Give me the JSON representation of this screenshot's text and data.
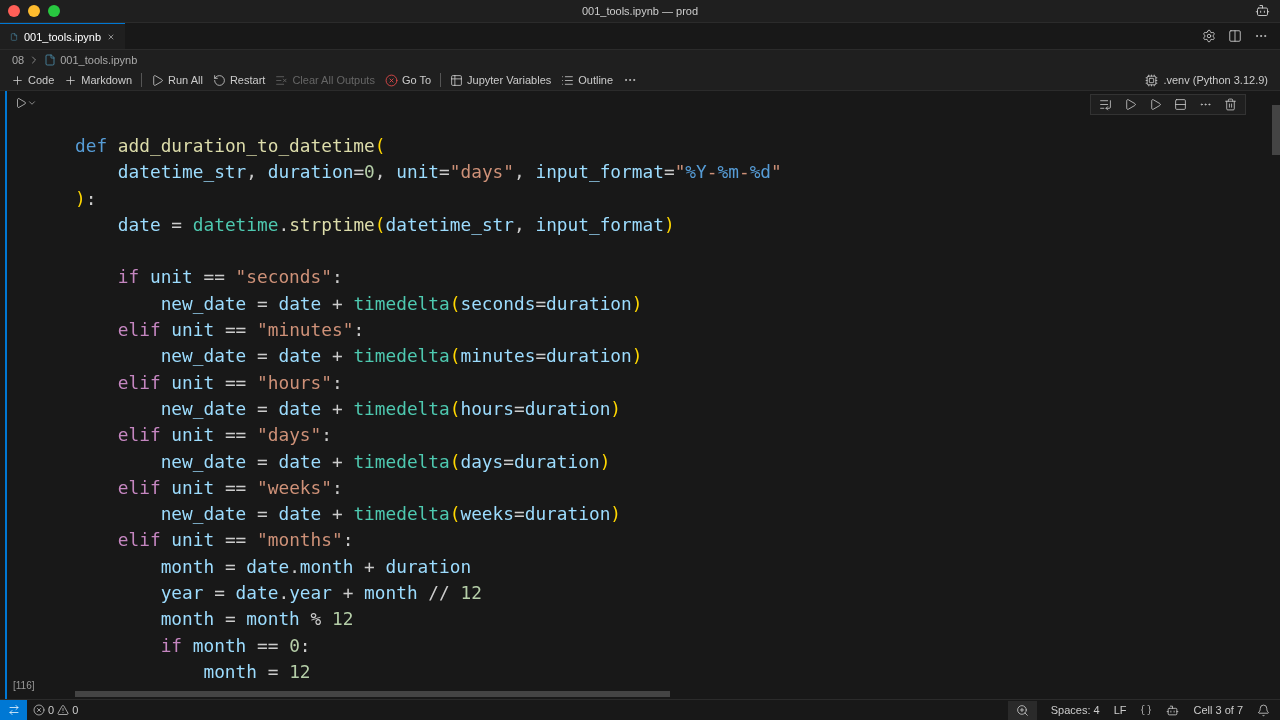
{
  "window": {
    "title": "001_tools.ipynb — prod"
  },
  "tabs": [
    {
      "label": "001_tools.ipynb",
      "selected": true
    }
  ],
  "breadcrumb": [
    "08",
    "001_tools.ipynb"
  ],
  "toolbar": {
    "groups": [
      [
        {
          "label": "Code",
          "disabled": false
        },
        {
          "label": "Markdown",
          "disabled": false
        }
      ],
      [
        {
          "label": "Run All",
          "disabled": false
        },
        {
          "label": "Restart",
          "disabled": false
        },
        {
          "label": "Clear All Outputs",
          "disabled": true
        },
        {
          "label": "Go To",
          "disabled": false
        }
      ],
      [
        {
          "label": "Jupyter Variables",
          "disabled": false
        },
        {
          "label": "Outline",
          "disabled": false
        }
      ]
    ],
    "kernel": ".venv (Python 3.12.9)"
  },
  "cell": {
    "execution_count": "[116]",
    "lines": [
      {
        "tokens": [
          {
            "kind": "keyword",
            "text": "def "
          },
          {
            "kind": "function",
            "text": "add_duration_to_datetime"
          },
          {
            "kind": "bracket",
            "text": "("
          }
        ]
      },
      {
        "tokens": [
          {
            "kind": "variable",
            "text": "    datetime_str"
          },
          {
            "kind": "plain",
            "text": ", "
          },
          {
            "kind": "variable",
            "text": "duration"
          },
          {
            "kind": "plain",
            "text": "="
          },
          {
            "kind": "number",
            "text": "0"
          },
          {
            "kind": "plain",
            "text": ", "
          },
          {
            "kind": "variable",
            "text": "unit"
          },
          {
            "kind": "plain",
            "text": "="
          },
          {
            "kind": "string",
            "text": "\"days\""
          },
          {
            "kind": "plain",
            "text": ", "
          },
          {
            "kind": "variable",
            "text": "input_format"
          },
          {
            "kind": "plain",
            "text": "="
          },
          {
            "kind": "string",
            "text": "\""
          },
          {
            "kind": "format",
            "text": "%Y"
          },
          {
            "kind": "string",
            "text": "-"
          },
          {
            "kind": "format",
            "text": "%m"
          },
          {
            "kind": "string",
            "text": "-"
          },
          {
            "kind": "format",
            "text": "%d"
          },
          {
            "kind": "string",
            "text": "\""
          }
        ]
      },
      {
        "tokens": [
          {
            "kind": "bracket",
            "text": ")"
          },
          {
            "kind": "plain",
            "text": ":"
          }
        ]
      },
      {
        "tokens": [
          {
            "kind": "variable",
            "text": "    date"
          },
          {
            "kind": "plain",
            "text": " = "
          },
          {
            "kind": "class",
            "text": "datetime"
          },
          {
            "kind": "plain",
            "text": "."
          },
          {
            "kind": "function",
            "text": "strptime"
          },
          {
            "kind": "bracket",
            "text": "("
          },
          {
            "kind": "variable",
            "text": "datetime_str"
          },
          {
            "kind": "plain",
            "text": ", "
          },
          {
            "kind": "variable",
            "text": "input_format"
          },
          {
            "kind": "bracket",
            "text": ")"
          }
        ]
      },
      {
        "gap_before": true,
        "tokens": [
          {
            "kind": "control",
            "text": "    if "
          },
          {
            "kind": "variable",
            "text": "unit"
          },
          {
            "kind": "plain",
            "text": " == "
          },
          {
            "kind": "string",
            "text": "\"seconds\""
          },
          {
            "kind": "plain",
            "text": ":"
          }
        ]
      },
      {
        "tokens": [
          {
            "kind": "variable",
            "text": "        new_date"
          },
          {
            "kind": "plain",
            "text": " = "
          },
          {
            "kind": "variable",
            "text": "date"
          },
          {
            "kind": "plain",
            "text": " + "
          },
          {
            "kind": "class",
            "text": "timedelta"
          },
          {
            "kind": "bracket",
            "text": "("
          },
          {
            "kind": "variable",
            "text": "seconds"
          },
          {
            "kind": "plain",
            "text": "="
          },
          {
            "kind": "variable",
            "text": "duration"
          },
          {
            "kind": "bracket",
            "text": ")"
          }
        ]
      },
      {
        "tokens": [
          {
            "kind": "control",
            "text": "    elif "
          },
          {
            "kind": "variable",
            "text": "unit"
          },
          {
            "kind": "plain",
            "text": " == "
          },
          {
            "kind": "string",
            "text": "\"minutes\""
          },
          {
            "kind": "plain",
            "text": ":"
          }
        ]
      },
      {
        "tokens": [
          {
            "kind": "variable",
            "text": "        new_date"
          },
          {
            "kind": "plain",
            "text": " = "
          },
          {
            "kind": "variable",
            "text": "date"
          },
          {
            "kind": "plain",
            "text": " + "
          },
          {
            "kind": "class",
            "text": "timedelta"
          },
          {
            "kind": "bracket",
            "text": "("
          },
          {
            "kind": "variable",
            "text": "minutes"
          },
          {
            "kind": "plain",
            "text": "="
          },
          {
            "kind": "variable",
            "text": "duration"
          },
          {
            "kind": "bracket",
            "text": ")"
          }
        ]
      },
      {
        "tokens": [
          {
            "kind": "control",
            "text": "    elif "
          },
          {
            "kind": "variable",
            "text": "unit"
          },
          {
            "kind": "plain",
            "text": " == "
          },
          {
            "kind": "string",
            "text": "\"hours\""
          },
          {
            "kind": "plain",
            "text": ":"
          }
        ]
      },
      {
        "tokens": [
          {
            "kind": "variable",
            "text": "        new_date"
          },
          {
            "kind": "plain",
            "text": " = "
          },
          {
            "kind": "variable",
            "text": "date"
          },
          {
            "kind": "plain",
            "text": " + "
          },
          {
            "kind": "class",
            "text": "timedelta"
          },
          {
            "kind": "bracket",
            "text": "("
          },
          {
            "kind": "variable",
            "text": "hours"
          },
          {
            "kind": "plain",
            "text": "="
          },
          {
            "kind": "variable",
            "text": "duration"
          },
          {
            "kind": "bracket",
            "text": ")"
          }
        ]
      },
      {
        "tokens": [
          {
            "kind": "control",
            "text": "    elif "
          },
          {
            "kind": "variable",
            "text": "unit"
          },
          {
            "kind": "plain",
            "text": " == "
          },
          {
            "kind": "string",
            "text": "\"days\""
          },
          {
            "kind": "plain",
            "text": ":"
          }
        ]
      },
      {
        "tokens": [
          {
            "kind": "variable",
            "text": "        new_date"
          },
          {
            "kind": "plain",
            "text": " = "
          },
          {
            "kind": "variable",
            "text": "date"
          },
          {
            "kind": "plain",
            "text": " + "
          },
          {
            "kind": "class",
            "text": "timedelta"
          },
          {
            "kind": "bracket",
            "text": "("
          },
          {
            "kind": "variable",
            "text": "days"
          },
          {
            "kind": "plain",
            "text": "="
          },
          {
            "kind": "variable",
            "text": "duration"
          },
          {
            "kind": "bracket",
            "text": ")"
          }
        ]
      },
      {
        "tokens": [
          {
            "kind": "control",
            "text": "    elif "
          },
          {
            "kind": "variable",
            "text": "unit"
          },
          {
            "kind": "plain",
            "text": " == "
          },
          {
            "kind": "string",
            "text": "\"weeks\""
          },
          {
            "kind": "plain",
            "text": ":"
          }
        ]
      },
      {
        "tokens": [
          {
            "kind": "variable",
            "text": "        new_date"
          },
          {
            "kind": "plain",
            "text": " = "
          },
          {
            "kind": "variable",
            "text": "date"
          },
          {
            "kind": "plain",
            "text": " + "
          },
          {
            "kind": "class",
            "text": "timedelta"
          },
          {
            "kind": "bracket",
            "text": "("
          },
          {
            "kind": "variable",
            "text": "weeks"
          },
          {
            "kind": "plain",
            "text": "="
          },
          {
            "kind": "variable",
            "text": "duration"
          },
          {
            "kind": "bracket",
            "text": ")"
          }
        ]
      },
      {
        "tokens": [
          {
            "kind": "control",
            "text": "    elif "
          },
          {
            "kind": "variable",
            "text": "unit"
          },
          {
            "kind": "plain",
            "text": " == "
          },
          {
            "kind": "string",
            "text": "\"months\""
          },
          {
            "kind": "plain",
            "text": ":"
          }
        ]
      },
      {
        "tokens": [
          {
            "kind": "variable",
            "text": "        month"
          },
          {
            "kind": "plain",
            "text": " = "
          },
          {
            "kind": "variable",
            "text": "date"
          },
          {
            "kind": "plain",
            "text": "."
          },
          {
            "kind": "variable",
            "text": "month"
          },
          {
            "kind": "plain",
            "text": " + "
          },
          {
            "kind": "variable",
            "text": "duration"
          }
        ]
      },
      {
        "tokens": [
          {
            "kind": "variable",
            "text": "        year"
          },
          {
            "kind": "plain",
            "text": " = "
          },
          {
            "kind": "variable",
            "text": "date"
          },
          {
            "kind": "plain",
            "text": "."
          },
          {
            "kind": "variable",
            "text": "year"
          },
          {
            "kind": "plain",
            "text": " + "
          },
          {
            "kind": "variable",
            "text": "month"
          },
          {
            "kind": "plain",
            "text": " // "
          },
          {
            "kind": "number",
            "text": "12"
          }
        ]
      },
      {
        "tokens": [
          {
            "kind": "variable",
            "text": "        month"
          },
          {
            "kind": "plain",
            "text": " = "
          },
          {
            "kind": "variable",
            "text": "month"
          },
          {
            "kind": "plain",
            "text": " % "
          },
          {
            "kind": "number",
            "text": "12"
          }
        ]
      },
      {
        "tokens": [
          {
            "kind": "control",
            "text": "        if "
          },
          {
            "kind": "variable",
            "text": "month"
          },
          {
            "kind": "plain",
            "text": " == "
          },
          {
            "kind": "number",
            "text": "0"
          },
          {
            "kind": "plain",
            "text": ":"
          }
        ]
      },
      {
        "tokens": [
          {
            "kind": "variable",
            "text": "            month"
          },
          {
            "kind": "plain",
            "text": " = "
          },
          {
            "kind": "number",
            "text": "12"
          }
        ]
      }
    ]
  },
  "status_bar": {
    "errors": "0",
    "warnings": "0",
    "items": [
      "Spaces: 4",
      "LF",
      "Cell 3 of 7"
    ]
  }
}
